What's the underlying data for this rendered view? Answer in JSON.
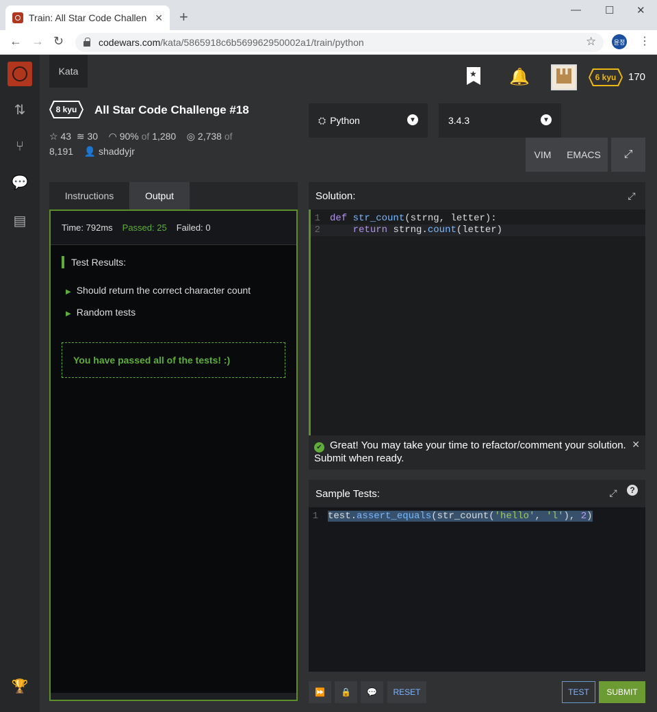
{
  "browser": {
    "tab_title": "Train: All Star Code Challen",
    "url_host": "codewars.com",
    "url_path": "/kata/5865918c6b569962950002a1/train/python",
    "profile_label": "윤정"
  },
  "nav": {
    "kata_label": "Kata",
    "user_rank": "6 kyu",
    "honor": "170"
  },
  "kata": {
    "rank": "8 kyu",
    "title": "All Star Code Challenge #18",
    "stars": "43",
    "collections": "30",
    "satisfaction": "90%",
    "of_label": "of",
    "votes": "1,280",
    "completed": "2,738",
    "of_label2": "of",
    "attempts": "8,191",
    "author": "shaddyjr"
  },
  "editor_settings": {
    "language": "Python",
    "version": "3.4.3",
    "vim_label": "VIM",
    "emacs_label": "EMACS"
  },
  "tabs": {
    "instructions": "Instructions",
    "output": "Output"
  },
  "output": {
    "time": "Time: 792ms",
    "passed": "Passed: 25",
    "failed": "Failed: 0",
    "results_title": "Test Results:",
    "results": [
      "Should return the correct character count",
      "Random tests"
    ],
    "pass_message": "You have passed all of the tests! :)"
  },
  "solution": {
    "title": "Solution:",
    "line1_num": "1",
    "line2_num": "2",
    "l1_def": "def",
    "l1_fn": "str_count",
    "l1_args": "(strng, letter):",
    "l2_return": "return",
    "l2_obj": "strng.",
    "l2_method": "count",
    "l2_args": "(letter)"
  },
  "flash": {
    "message": "Great! You may take your time to refactor/comment your solution. Submit when ready."
  },
  "sample_tests": {
    "title": "Sample Tests:",
    "line_num": "1",
    "t_obj": "test.",
    "t_method": "assert_equals",
    "t_open": "(str_count(",
    "t_s1": "'hello'",
    "t_comma": ", ",
    "t_s2": "'l'",
    "t_close1": "), ",
    "t_num": "2",
    "t_close2": ")"
  },
  "buttons": {
    "reset": "RESET",
    "test": "TEST",
    "submit": "SUBMIT"
  }
}
